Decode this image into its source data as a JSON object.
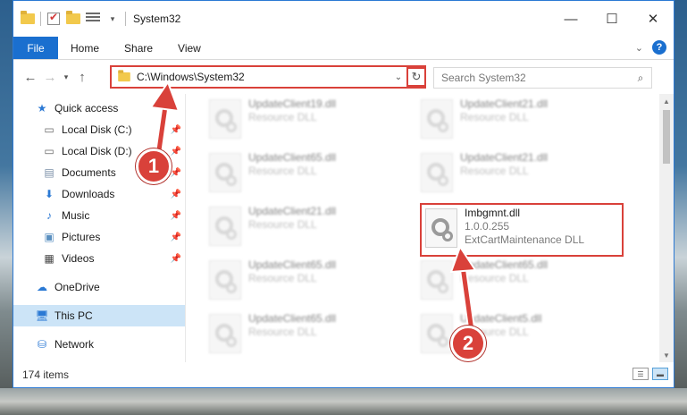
{
  "window": {
    "title": "System32",
    "controls": {
      "minimize": "—",
      "maximize": "☐",
      "close": "✕"
    }
  },
  "ribbon": {
    "tabs": [
      "File",
      "Home",
      "Share",
      "View"
    ]
  },
  "address": {
    "path": "C:\\Windows\\System32",
    "search_placeholder": "Search System32"
  },
  "sidebar": {
    "items": [
      {
        "label": "Quick access",
        "icon": "star-icon",
        "pinned": false
      },
      {
        "label": "Local Disk (C:)",
        "icon": "drive-icon",
        "pinned": true
      },
      {
        "label": "Local Disk (D:)",
        "icon": "drive-icon",
        "pinned": true
      },
      {
        "label": "Documents",
        "icon": "documents-icon",
        "pinned": true
      },
      {
        "label": "Downloads",
        "icon": "download-icon",
        "pinned": true
      },
      {
        "label": "Music",
        "icon": "music-icon",
        "pinned": true
      },
      {
        "label": "Pictures",
        "icon": "pictures-icon",
        "pinned": true
      },
      {
        "label": "Videos",
        "icon": "videos-icon",
        "pinned": true
      },
      {
        "label": "OneDrive",
        "icon": "cloud-icon",
        "pinned": false
      },
      {
        "label": "This PC",
        "icon": "computer-icon",
        "pinned": false,
        "selected": true
      },
      {
        "label": "Network",
        "icon": "network-icon",
        "pinned": false
      }
    ]
  },
  "files": [
    {
      "name": "UpdateClient19.dll",
      "type": "Resource DLL"
    },
    {
      "name": "UpdateClient21.dll",
      "type": "Resource DLL"
    },
    {
      "name": "UpdateClient65.dll",
      "type": "Resource DLL"
    },
    {
      "name": "UpdateClient21.dll",
      "type": "Resource DLL"
    },
    {
      "name": "UpdateClient21.dll",
      "type": "Resource DLL"
    },
    {
      "name": "Imbgmnt.dll",
      "version": "1.0.0.255",
      "type": "ExtCartMaintenance DLL",
      "highlighted": true
    },
    {
      "name": "UpdateClient65.dll",
      "type": "Resource DLL"
    },
    {
      "name": "UpdateClient65.dll",
      "type": "Resource DLL"
    },
    {
      "name": "UpdateClient65.dll",
      "type": "Resource DLL"
    },
    {
      "name": "UpdateClient5.dll",
      "type": "Resource DLL"
    }
  ],
  "status": {
    "item_count": "174 items"
  },
  "annotations": {
    "badge1": "1",
    "badge2": "2",
    "color": "#d9413a"
  }
}
